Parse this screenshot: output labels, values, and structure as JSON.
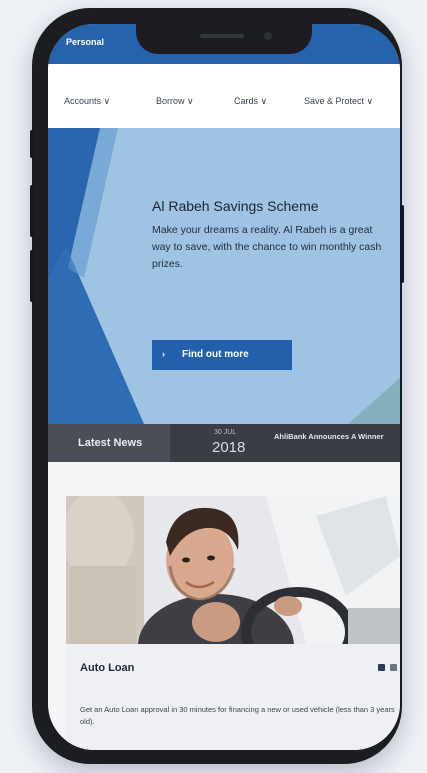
{
  "topbar": {
    "tab_label": "Personal"
  },
  "nav": {
    "items": [
      {
        "label": "Accounts ∨"
      },
      {
        "label": "Borrow ∨"
      },
      {
        "label": "Cards ∨"
      },
      {
        "label": "Save & Protect ∨"
      }
    ]
  },
  "hero": {
    "title": "Al Rabeh Savings Scheme",
    "text": "Make your dreams a reality. Al Rabeh is a great way to save, with the chance to win monthly cash prizes.",
    "cta_label": "Find out more",
    "cta_arrow": "›"
  },
  "news": {
    "label": "Latest News",
    "day": "30 JUL",
    "year": "2018",
    "headline": "AhliBank Announces A Winner"
  },
  "card": {
    "title": "Auto Loan",
    "text": "Get an Auto Loan approval in 30 minutes for financing a new or used vehicle (less than 3 years old)."
  },
  "colors": {
    "brand_blue": "#2563ad",
    "hero_bg": "#9fc3e3",
    "news_bar": "#393d44",
    "phone_frame": "#1b1d21"
  }
}
